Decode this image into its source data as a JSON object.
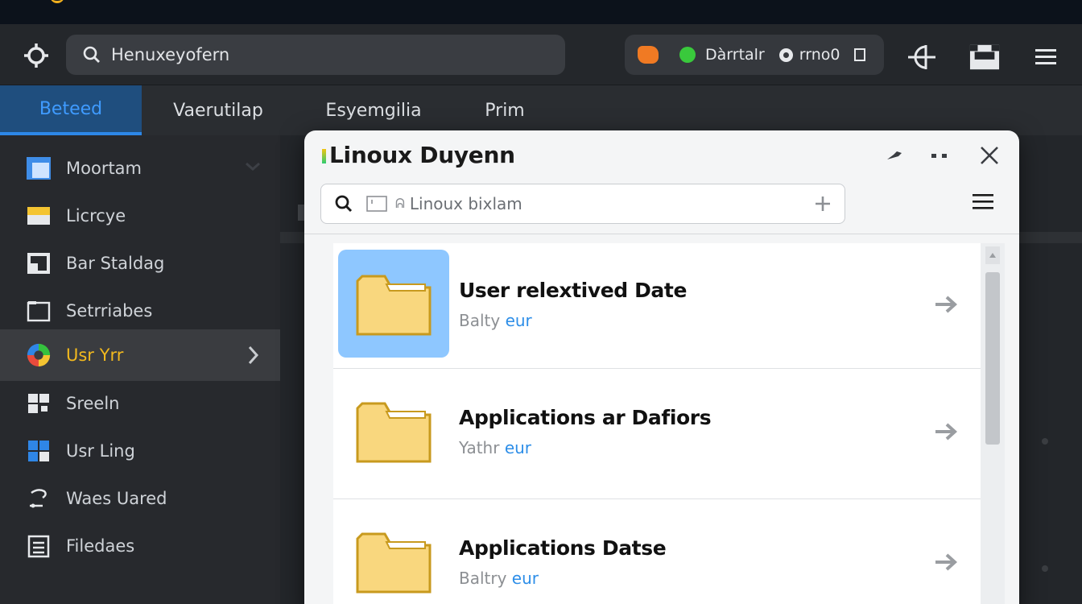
{
  "toolbar": {
    "search_placeholder": "Henuxeyofern",
    "status_label": "Dàrrtalr",
    "status_value": "rrno0"
  },
  "tabs": [
    {
      "label": "Beteed",
      "active": true
    },
    {
      "label": "Vaerutilap",
      "active": false
    },
    {
      "label": "Esyemgilia",
      "active": false
    },
    {
      "label": "Prim",
      "active": false
    }
  ],
  "sidebar": {
    "items": [
      {
        "label": "Moortam",
        "icon": "window-icon"
      },
      {
        "label": "Licrcye",
        "icon": "folder-tab-icon"
      },
      {
        "label": "Bar Staldag",
        "icon": "chart-icon"
      },
      {
        "label": "Setrriabes",
        "icon": "square-icon"
      },
      {
        "label": "Usr Yrr",
        "icon": "color-wheel-icon",
        "active": true
      },
      {
        "label": "Sreeln",
        "icon": "grid-icon"
      },
      {
        "label": "Usr Ling",
        "icon": "puzzle-icon"
      },
      {
        "label": "Waes Uared",
        "icon": "hook-icon"
      },
      {
        "label": "Filedaes",
        "icon": "document-icon"
      }
    ]
  },
  "dialog": {
    "title": "Linoux Duyenn",
    "search_placeholder": "Linoux bixlam",
    "search_prefix": "ᕱ"
  },
  "rows": [
    {
      "title": "User relextived Date",
      "sub_gray": "Balty",
      "sub_blue": "eur",
      "selected": true
    },
    {
      "title": "Applications ar Dafiors",
      "sub_gray": "Yathr",
      "sub_blue": "eur",
      "selected": false
    },
    {
      "title": "Applications Datse",
      "sub_gray": "Baltry",
      "sub_blue": "eur",
      "selected": false
    }
  ],
  "colors": {
    "accent_blue": "#2d87e8",
    "active_sidebar": "#f2b91e",
    "folder_fill": "#f9d77e",
    "folder_stroke": "#c89a1e"
  }
}
